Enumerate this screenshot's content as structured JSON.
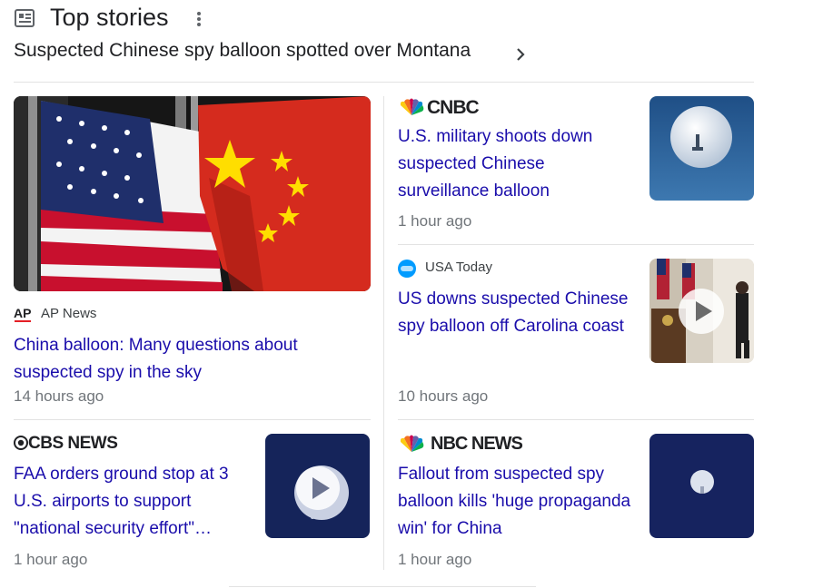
{
  "header": {
    "title": "Top stories",
    "icon": "newspaper-icon",
    "more": "more-vert-icon"
  },
  "topic": {
    "label": "Suspected Chinese spy balloon spotted over Montana",
    "icon": "chevron-right-icon"
  },
  "stories": {
    "ap": {
      "source_logo": "AP",
      "source_name": "AP News",
      "headline": "China balloon: Many questions about suspected spy in the sky",
      "time": "14 hours ago",
      "image": "us-china-flags"
    },
    "cnbc": {
      "source_logo": "CNBC",
      "headline": "U.S. military shoots down suspected Chinese surveillance balloon",
      "time": "1 hour ago",
      "image": "balloon-in-sky"
    },
    "usatoday": {
      "source_name": "USA Today",
      "headline": "US downs suspected Chinese spy balloon off Carolina coast",
      "time": "10 hours ago",
      "image": "podium-video",
      "play_icon": "play-icon"
    },
    "cbs": {
      "source_logo": "CBS NEWS",
      "headline": "FAA orders ground stop at 3 U.S. airports to support \"national security effort\"…",
      "time": "1 hour ago",
      "image": "balloon-video",
      "play_icon": "play-icon"
    },
    "nbc": {
      "source_logo": "NBC NEWS",
      "headline": "Fallout from suspected spy balloon kills 'huge propaganda win' for China",
      "time": "1 hour ago",
      "image": "balloon-dark-sky"
    }
  },
  "colors": {
    "link": "#1a0dab",
    "meta": "#70757a",
    "divider": "#e3e3e3",
    "ap_red": "#e41f26",
    "usatoday_blue": "#009bff"
  }
}
